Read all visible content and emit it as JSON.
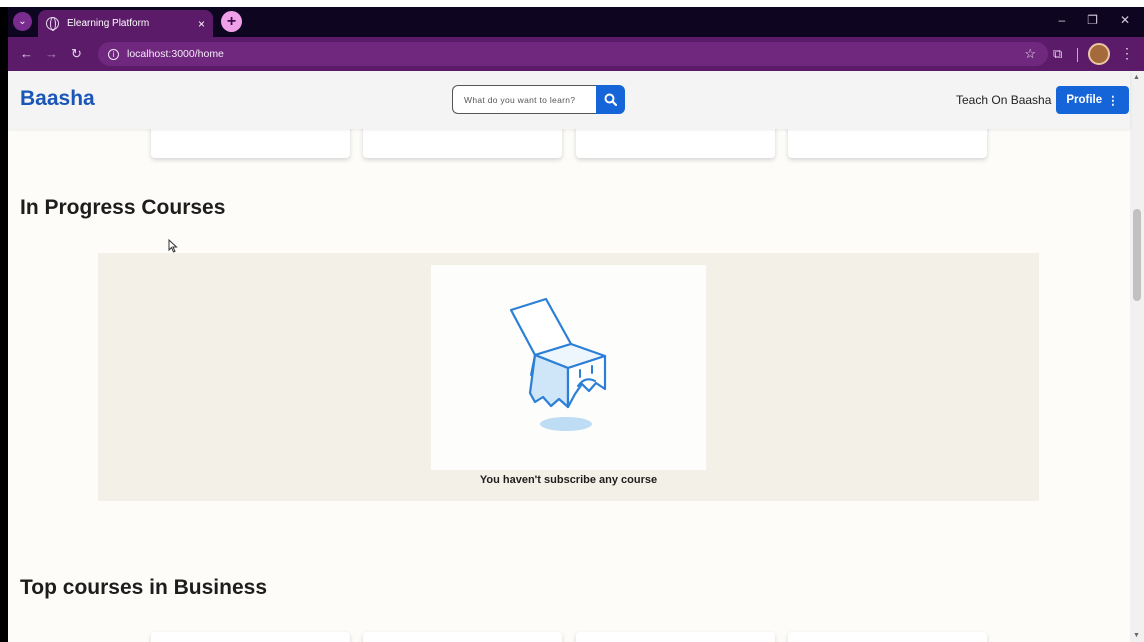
{
  "browser": {
    "tab_title": "Elearning Platform",
    "tab_close": "×",
    "new_tab": "+",
    "url": "localhost:3000/home",
    "controls": {
      "minimize": "–",
      "restore": "❐",
      "close": "✕"
    }
  },
  "navbar": {
    "brand": "Baasha",
    "search_placeholder": "What do you want to learn?",
    "teach_link": "Teach On Baasha",
    "profile_label": "Profile",
    "profile_menu_glyph": "⋮"
  },
  "sections": {
    "in_progress_title": "In Progress Courses",
    "empty_message": "You haven't subscribe any course",
    "business_title": "Top courses in Business"
  },
  "colors": {
    "brand": "#1a56b8",
    "primary_button": "#1565d8",
    "browser_frame": "#5b1b68",
    "empty_panel": "#f3f0e8",
    "illustration_stroke": "#2b7fd6"
  },
  "icons": [
    "globe-icon",
    "search-icon",
    "star-icon",
    "extensions-icon",
    "empty-box-icon",
    "cursor-icon"
  ]
}
